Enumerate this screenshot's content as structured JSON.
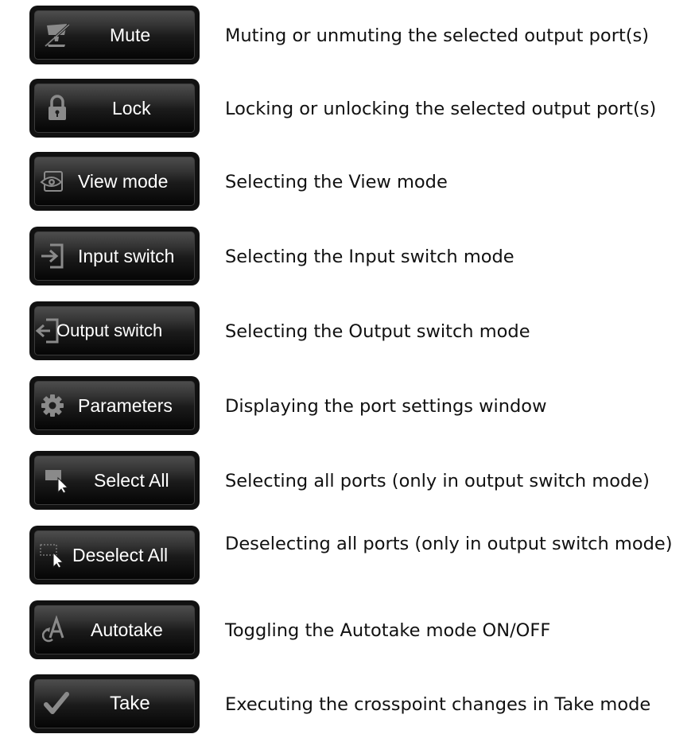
{
  "buttons": [
    {
      "label": "Mute",
      "icon": "mute-icon",
      "description": "Muting or unmuting the selected output port(s)"
    },
    {
      "label": "Lock",
      "icon": "lock-icon",
      "description": "Locking or unlocking the selected output port(s)"
    },
    {
      "label": "View mode",
      "icon": "eye-icon",
      "description": "Selecting the View mode"
    },
    {
      "label": "Input switch",
      "icon": "input-switch-icon",
      "description": "Selecting the Input switch mode"
    },
    {
      "label": "Output switch",
      "icon": "output-switch-icon",
      "description": "Selecting the Output switch mode"
    },
    {
      "label": "Parameters",
      "icon": "gear-icon",
      "description": "Displaying the port settings window"
    },
    {
      "label": "Select All",
      "icon": "select-all-icon",
      "description": "Selecting all ports (only in output switch mode)"
    },
    {
      "label": "Deselect All",
      "icon": "deselect-all-icon",
      "description": "Deselecting all ports (only in output switch mode)"
    },
    {
      "label": "Autotake",
      "icon": "autotake-icon",
      "description": "Toggling the Autotake mode ON/OFF"
    },
    {
      "label": "Take",
      "icon": "check-icon",
      "description": "Executing the crosspoint changes in Take mode"
    }
  ],
  "colors": {
    "button_text": "#ffffff",
    "icon_gray": "#8a8a8a",
    "description_text": "#111111"
  }
}
